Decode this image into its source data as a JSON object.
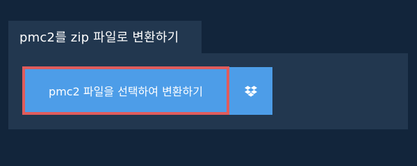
{
  "tab": {
    "title": "pmc2를 zip 파일로 변환하기"
  },
  "actions": {
    "convert_label": "pmc2 파일을 선택하여 변환하기",
    "dropbox_icon": "dropbox-icon"
  },
  "colors": {
    "page_background": "#12253b",
    "panel_background": "#22374f",
    "button_blue": "#4d9de8",
    "highlight_border": "#e05c5c"
  }
}
